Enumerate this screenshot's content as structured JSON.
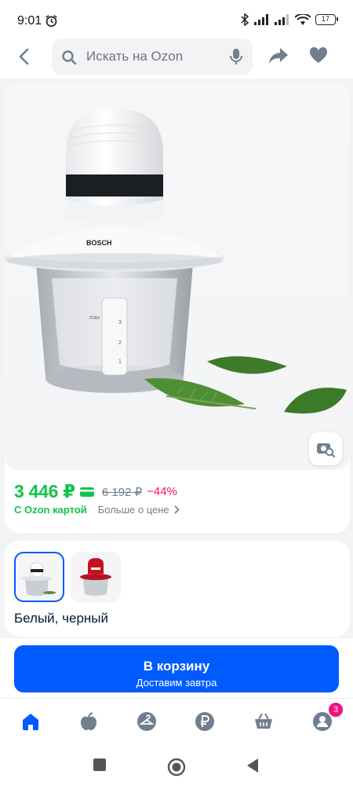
{
  "status_bar": {
    "time": "9:01",
    "battery": "17",
    "icons": [
      "alarm-icon",
      "bluetooth-icon",
      "signal-icon",
      "signal-icon",
      "wifi-icon",
      "battery-icon"
    ]
  },
  "header": {
    "search_placeholder": "Искать на Ozon",
    "icons": [
      "back-arrow-icon",
      "search-icon",
      "microphone-icon",
      "share-icon",
      "heart-icon"
    ]
  },
  "product": {
    "brand_on_image": "BOSCH",
    "image_markings": [
      "max",
      "3",
      "2",
      "1"
    ],
    "price_current": "3 446 ₽",
    "price_old": "6 192 ₽",
    "discount": "−44%",
    "ozon_card_label": "С Ozon картой",
    "price_more_label": "Больше о цене",
    "photo_search_icon": "camera-search-icon"
  },
  "variants": {
    "items": [
      {
        "color": "white-black",
        "selected": true
      },
      {
        "color": "red",
        "selected": false
      }
    ],
    "selected_label": "Белый, черный"
  },
  "cart": {
    "label": "В корзину",
    "sublabel": "Доставим завтра"
  },
  "bottom_nav": {
    "items": [
      "home-icon",
      "fresh-apple-icon",
      "hanger-icon",
      "ruble-icon",
      "basket-icon",
      "profile-icon"
    ],
    "profile_badge": "3"
  },
  "colors": {
    "accent": "#005bff",
    "price_green": "#10c44c",
    "discount_red": "#f91155",
    "badge": "#f1117e"
  }
}
